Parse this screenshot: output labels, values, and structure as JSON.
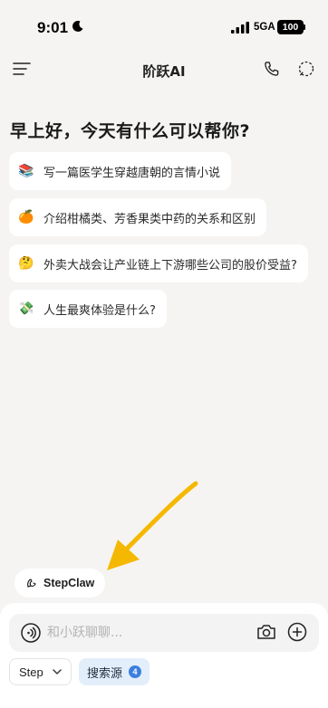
{
  "status_bar": {
    "time": "9:01",
    "network": "5GA",
    "battery": "100"
  },
  "header": {
    "title": "阶跃AI"
  },
  "greeting": "早上好，今天有什么可以帮你?",
  "suggestions": [
    {
      "emoji": "📚",
      "text": "写一篇医学生穿越唐朝的言情小说"
    },
    {
      "emoji": "🍊",
      "text": "介绍柑橘类、芳香果类中药的关系和区别"
    },
    {
      "emoji": "🤔",
      "text": "外卖大战会让产业链上下游哪些公司的股价受益?"
    },
    {
      "emoji": "💸",
      "text": "人生最爽体验是什么?"
    }
  ],
  "stepclaw": {
    "label": "StepClaw"
  },
  "input": {
    "placeholder": "和小跃聊聊..."
  },
  "model_select": {
    "value": "Step"
  },
  "search_source": {
    "label": "搜索源",
    "count": "4"
  },
  "colors": {
    "background": "#f5f4f2",
    "arrow": "#f5b800",
    "badge": "#3b7fe0"
  }
}
